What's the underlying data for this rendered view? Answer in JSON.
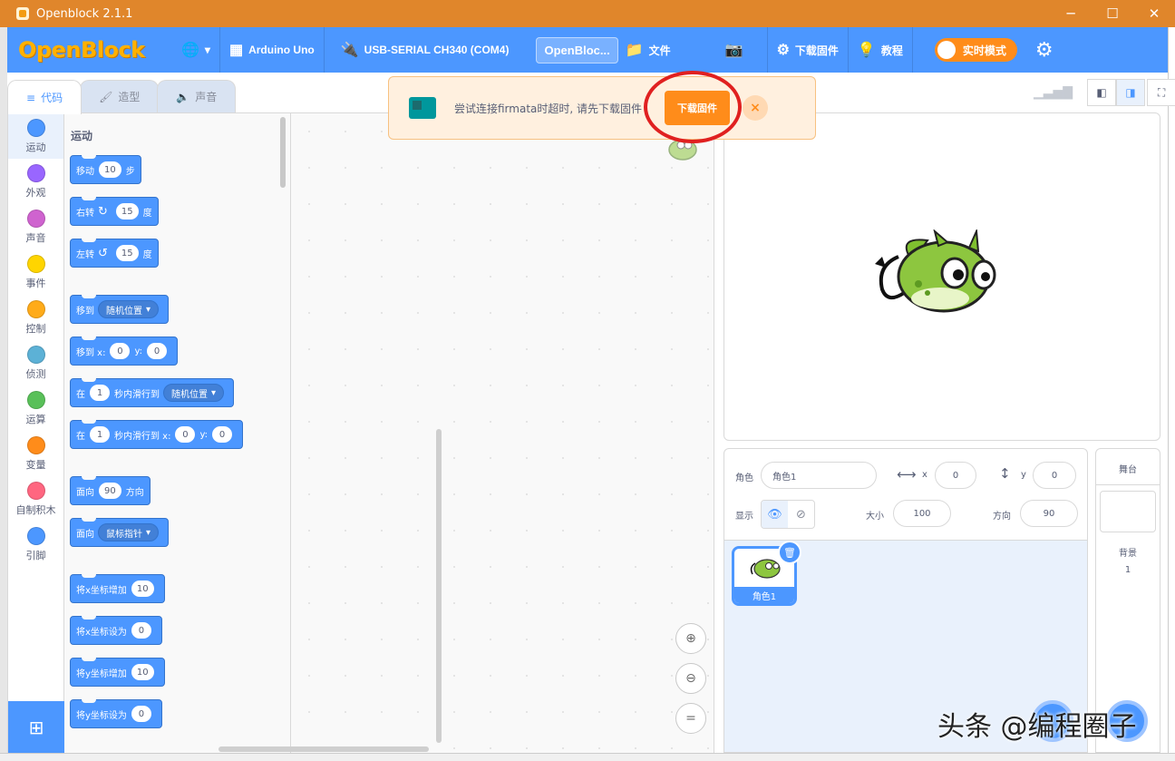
{
  "window": {
    "title": "Openblock 2.1.1",
    "minimize": "─",
    "maximize": "☐",
    "close": "✕"
  },
  "menubar": {
    "logo": "OpenBlock",
    "language_icon": "globe-icon",
    "device": "Arduino Uno",
    "port": "USB-SERIAL CH340 (COM4)",
    "project_name": "OpenBloc...",
    "file": "文件",
    "upload_firmware": "下载固件",
    "tutorials": "教程",
    "realtime_mode": "实时模式",
    "accent": "#4c97ff"
  },
  "tabs": [
    "代码",
    "造型",
    "声音"
  ],
  "categories": [
    {
      "label": "运动",
      "color": "#4c97ff"
    },
    {
      "label": "外观",
      "color": "#9966ff"
    },
    {
      "label": "声音",
      "color": "#cf63cf"
    },
    {
      "label": "事件",
      "color": "#ffd500"
    },
    {
      "label": "控制",
      "color": "#ffab19"
    },
    {
      "label": "侦测",
      "color": "#5cb1d6"
    },
    {
      "label": "运算",
      "color": "#59c059"
    },
    {
      "label": "变量",
      "color": "#ff8c1a"
    },
    {
      "label": "自制积木",
      "color": "#ff6680"
    },
    {
      "label": "引脚",
      "color": "#4c97ff"
    }
  ],
  "palette": {
    "section_label": "运动",
    "blocks": {
      "move": {
        "a": "移动",
        "v": "10",
        "b": "步"
      },
      "turn_right": {
        "a": "右转",
        "v": "15",
        "b": "度"
      },
      "turn_left": {
        "a": "左转",
        "v": "15",
        "b": "度"
      },
      "goto": {
        "a": "移到",
        "dd": "随机位置"
      },
      "goto_xy": {
        "a": "移到 x:",
        "x": "0",
        "b": "y:",
        "y": "0"
      },
      "glide": {
        "a": "在",
        "v": "1",
        "b": "秒内滑行到",
        "dd": "随机位置"
      },
      "glide_xy": {
        "a": "在",
        "v": "1",
        "b": "秒内滑行到 x:",
        "x": "0",
        "c": "y:",
        "y": "0"
      },
      "point_dir": {
        "a": "面向",
        "v": "90",
        "b": "方向"
      },
      "point_towards": {
        "a": "面向",
        "dd": "鼠标指针"
      },
      "change_x": {
        "a": "将x坐标增加",
        "v": "10"
      },
      "set_x": {
        "a": "将x坐标设为",
        "v": "0"
      },
      "change_y": {
        "a": "将y坐标增加",
        "v": "10"
      },
      "set_y": {
        "a": "将y坐标设为",
        "v": "0"
      }
    }
  },
  "alert": {
    "message": "尝试连接firmata时超时, 请先下载固件",
    "button": "下载固件",
    "close": "×",
    "bg": "#fff0df",
    "button_color": "#ff8c1a"
  },
  "zoom": {
    "in": "⊕",
    "out": "⊖",
    "reset": "="
  },
  "sprite_info": {
    "sprite_label": "角色",
    "sprite_name": "角色1",
    "x_label": "x",
    "x_value": "0",
    "y_label": "y",
    "y_value": "0",
    "show_label": "显示",
    "size_label": "大小",
    "size_value": "100",
    "direction_label": "方向",
    "direction_value": "90"
  },
  "sprites": [
    {
      "name": "角色1"
    }
  ],
  "backdrop": {
    "title": "舞台",
    "label": "背景",
    "count": "1"
  },
  "watermark": "头条 @编程圈子"
}
